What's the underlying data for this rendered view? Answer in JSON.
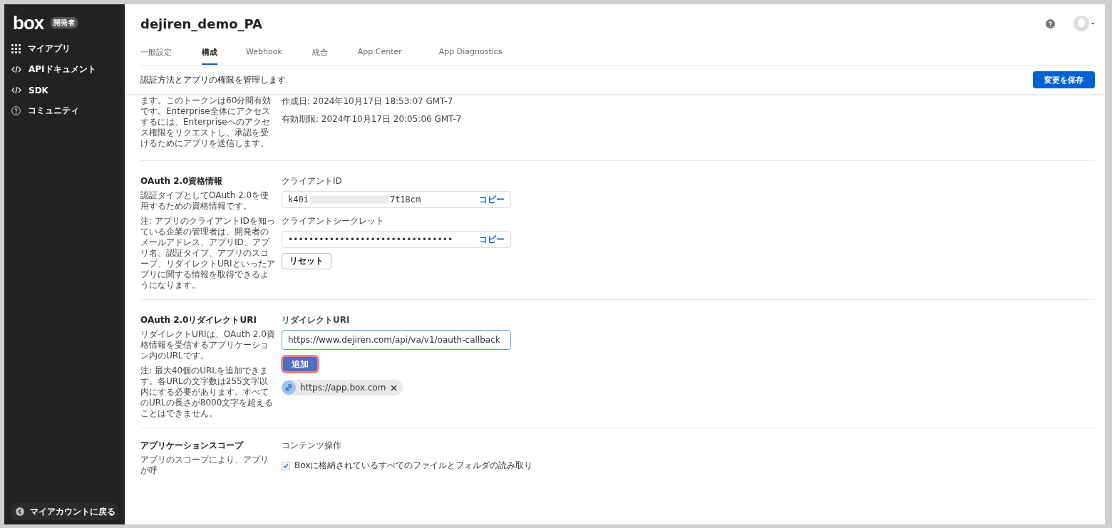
{
  "sidebar": {
    "logo": "box",
    "badge": "開発者",
    "items": [
      {
        "label": "マイアプリ"
      },
      {
        "label": "APIドキュメント"
      },
      {
        "label": "SDK"
      },
      {
        "label": "コミュニティ"
      }
    ],
    "back_button": "マイアカウントに戻る"
  },
  "header": {
    "title": "dejiren_demo_PA",
    "tabs": [
      {
        "label": "一般設定",
        "selected": false
      },
      {
        "label": "構成",
        "selected": true
      },
      {
        "label": "Webhook",
        "selected": false
      },
      {
        "label": "統合",
        "selected": false
      },
      {
        "label": "App Center",
        "selected": false
      },
      {
        "label": "App Diagnostics",
        "selected": false
      }
    ],
    "subtitle": "認証方法とアプリの権限を管理します",
    "save_button": "変更を保存"
  },
  "token_section": {
    "description": "ます。このトークンは60分間有効です。Enterprise全体にアクセスするには、Enterpriseへのアクセス権限をリクエストし、承認を受けるためにアプリを送信します。",
    "created": "作成日: 2024年10月17日 18:53:07 GMT-7",
    "expires": "有効期限: 2024年10月17日 20:05:06 GMT-7"
  },
  "credentials_section": {
    "title": "OAuth 2.0資格情報",
    "description": "認証タイプとしてOAuth 2.0を使用するための資格情報です。",
    "note": "注: アプリのクライアントIDを知っている企業の管理者は、開発者のメールアドレス、アプリID、アプリ名、認証タイプ、アプリのスコープ、リダイレクトURIといったアプリに関する情報を取得できるようになります。",
    "client_id_label": "クライアントID",
    "client_id_start": "k40i",
    "client_id_end": "7t18cm",
    "client_id_blurred": true,
    "copy_1": "コピー",
    "secret_label": "クライアントシークレット",
    "secret_value": "••••••••••••••••••••••••••••••••",
    "copy_2": "コピー",
    "reset_button": "リセット"
  },
  "redirect_section": {
    "title": "OAuth 2.0リダイレクトURI",
    "description": "リダイレクトURIは、OAuth 2.0資格情報を受信するアプリケーション内のURLです。",
    "note": "注: 最大40個のURLを追加できます。各URLの文字数は255文字以内にする必要があります。すべてのURLの長さが8000文字を超えることはできません。",
    "field_label": "リダイレクトURI",
    "field_value": "https://www.dejiren.com/api/va/v1/oauth-callback",
    "add_button": "追加",
    "add_highlighted": true,
    "uris": [
      "https://app.box.com"
    ]
  },
  "scope_section": {
    "title": "アプリケーションスコープ",
    "description": "アプリのスコープにより、アプリが呼",
    "group_label": "コンテンツ操作",
    "options": [
      {
        "label": "Boxに格納されているすべてのファイルとフォルダの読み取り",
        "checked": true
      }
    ]
  }
}
